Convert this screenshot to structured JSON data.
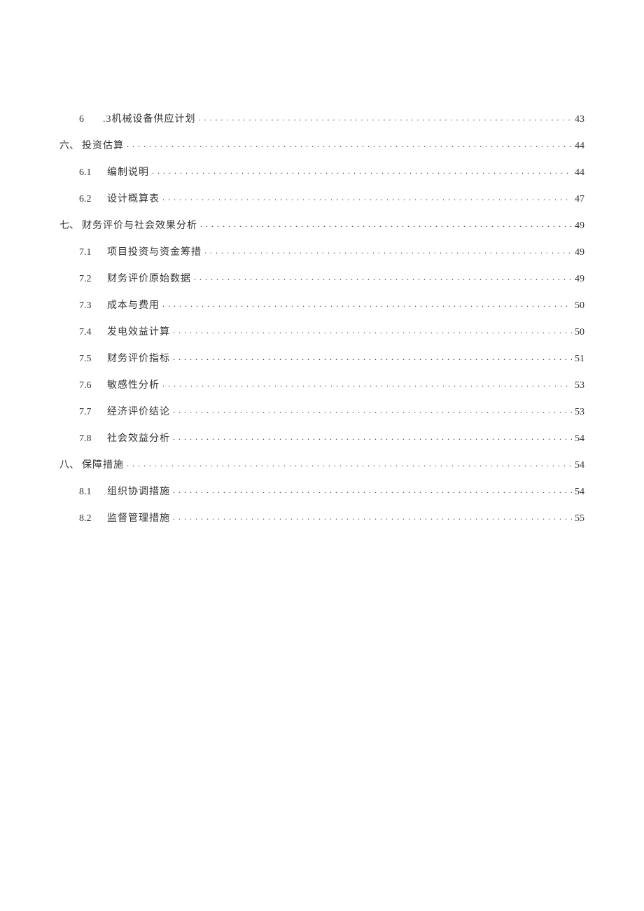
{
  "toc": [
    {
      "level": 2,
      "num": "6",
      "title": ".3机械设备供应计划",
      "page": "43",
      "title_ml": "4px"
    },
    {
      "level": 1,
      "num": "六、",
      "title": "投资估算",
      "page": "44"
    },
    {
      "level": 2,
      "num": "6.1",
      "title": "编制说明",
      "page": "44"
    },
    {
      "level": 2,
      "num": "6.2",
      "title": "设计概算表",
      "page": "47"
    },
    {
      "level": 1,
      "num": "七、",
      "title": "财务评价与社会效果分析",
      "page": "49"
    },
    {
      "level": 2,
      "num": "7.1",
      "title": "项目投资与资金筹措",
      "page": "49"
    },
    {
      "level": 2,
      "num": "7.2",
      "title": "财务评价原始数据",
      "page": "49"
    },
    {
      "level": 2,
      "num": "7.3",
      "title": "成本与费用",
      "page": "50"
    },
    {
      "level": 2,
      "num": "7.4",
      "title": "发电效益计算",
      "page": "50"
    },
    {
      "level": 2,
      "num": "7.5",
      "title": "财务评价指标",
      "page": "51"
    },
    {
      "level": 2,
      "num": "7.6",
      "title": "敏感性分析",
      "page": "53"
    },
    {
      "level": 2,
      "num": "7.7",
      "title": "经济评价结论",
      "page": "53"
    },
    {
      "level": 2,
      "num": "7.8",
      "title": "社会效益分析",
      "page": "54"
    },
    {
      "level": 1,
      "num": "八、",
      "title": "保障措施",
      "page": "54"
    },
    {
      "level": 2,
      "num": "8.1",
      "title": "组织协调措施",
      "page": "54"
    },
    {
      "level": 2,
      "num": "8.2",
      "title": "监督管理措施",
      "page": "55"
    }
  ]
}
